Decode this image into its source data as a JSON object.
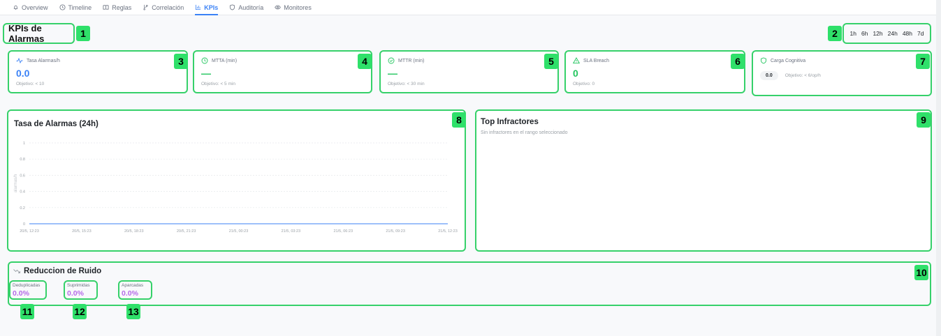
{
  "nav": {
    "tabs": [
      {
        "label": "Overview",
        "icon": "bell-icon",
        "active": false
      },
      {
        "label": "Timeline",
        "icon": "clock-icon",
        "active": false
      },
      {
        "label": "Reglas",
        "icon": "book-icon",
        "active": false
      },
      {
        "label": "Correlación",
        "icon": "branch-icon",
        "active": false
      },
      {
        "label": "KPIs",
        "icon": "bar-chart-icon",
        "active": true
      },
      {
        "label": "Auditoría",
        "icon": "shield-icon",
        "active": false
      },
      {
        "label": "Monitores",
        "icon": "eye-icon",
        "active": false
      }
    ]
  },
  "page": {
    "title": "KPIs de Alarmas"
  },
  "range": {
    "options": [
      "1h",
      "6h",
      "12h",
      "24h",
      "48h",
      "7d"
    ]
  },
  "kpis": [
    {
      "label": "Tasa Alarmas/h",
      "value": "0.0",
      "objective": "Objetivo: < 10",
      "icon": "activity-icon",
      "color": "#3b82f6"
    },
    {
      "label": "MTTA (min)",
      "value": "—",
      "objective": "Objetivo: < 5 min",
      "icon": "clock-icon",
      "color": "#22c55e"
    },
    {
      "label": "MTTR (min)",
      "value": "—",
      "objective": "Objetivo: < 30 min",
      "icon": "check-circle-icon",
      "color": "#22c55e"
    },
    {
      "label": "SLA Breach",
      "value": "0",
      "objective": "Objetivo: 0",
      "icon": "warning-icon",
      "color": "#22c55e"
    },
    {
      "label": "Carga Cognitiva",
      "value": "0.0",
      "objective": "Objetivo: < 6/op/h",
      "icon": "shield-icon",
      "color": "#22c55e"
    }
  ],
  "chart_panel": {
    "title": "Tasa de Alarmas (24h)"
  },
  "chart_data": {
    "type": "line",
    "title": "Tasa de Alarmas (24h)",
    "xlabel": "",
    "ylabel": "alarmas/h",
    "x": [
      "20/5, 12:23",
      "20/5, 15:23",
      "20/5, 18:23",
      "20/5, 21:23",
      "21/5, 00:23",
      "21/5, 03:23",
      "21/5, 06:23",
      "21/5, 09:23",
      "21/5, 12:23"
    ],
    "series": [
      {
        "values": [
          0,
          0,
          0,
          0,
          0,
          0,
          0,
          0,
          0
        ],
        "color": "#3b82f6"
      }
    ],
    "yticks": [
      "0",
      "0.2",
      "0.4",
      "0.6",
      "0.8",
      "1"
    ],
    "ylim": [
      0,
      1
    ],
    "grid": true
  },
  "infractores": {
    "title": "Top Infractores",
    "empty": "Sin infractores en el rango seleccionado"
  },
  "ruido": {
    "title": "Reduccion de Ruido",
    "stats": [
      {
        "label": "Deduplicadas",
        "value": "0.0%"
      },
      {
        "label": "Suprimidas",
        "value": "0.0%"
      },
      {
        "label": "Aparcadas",
        "value": "0.0%"
      }
    ]
  },
  "badges": [
    "1",
    "2",
    "3",
    "4",
    "5",
    "6",
    "7",
    "8",
    "9",
    "10",
    "11",
    "12",
    "13"
  ]
}
